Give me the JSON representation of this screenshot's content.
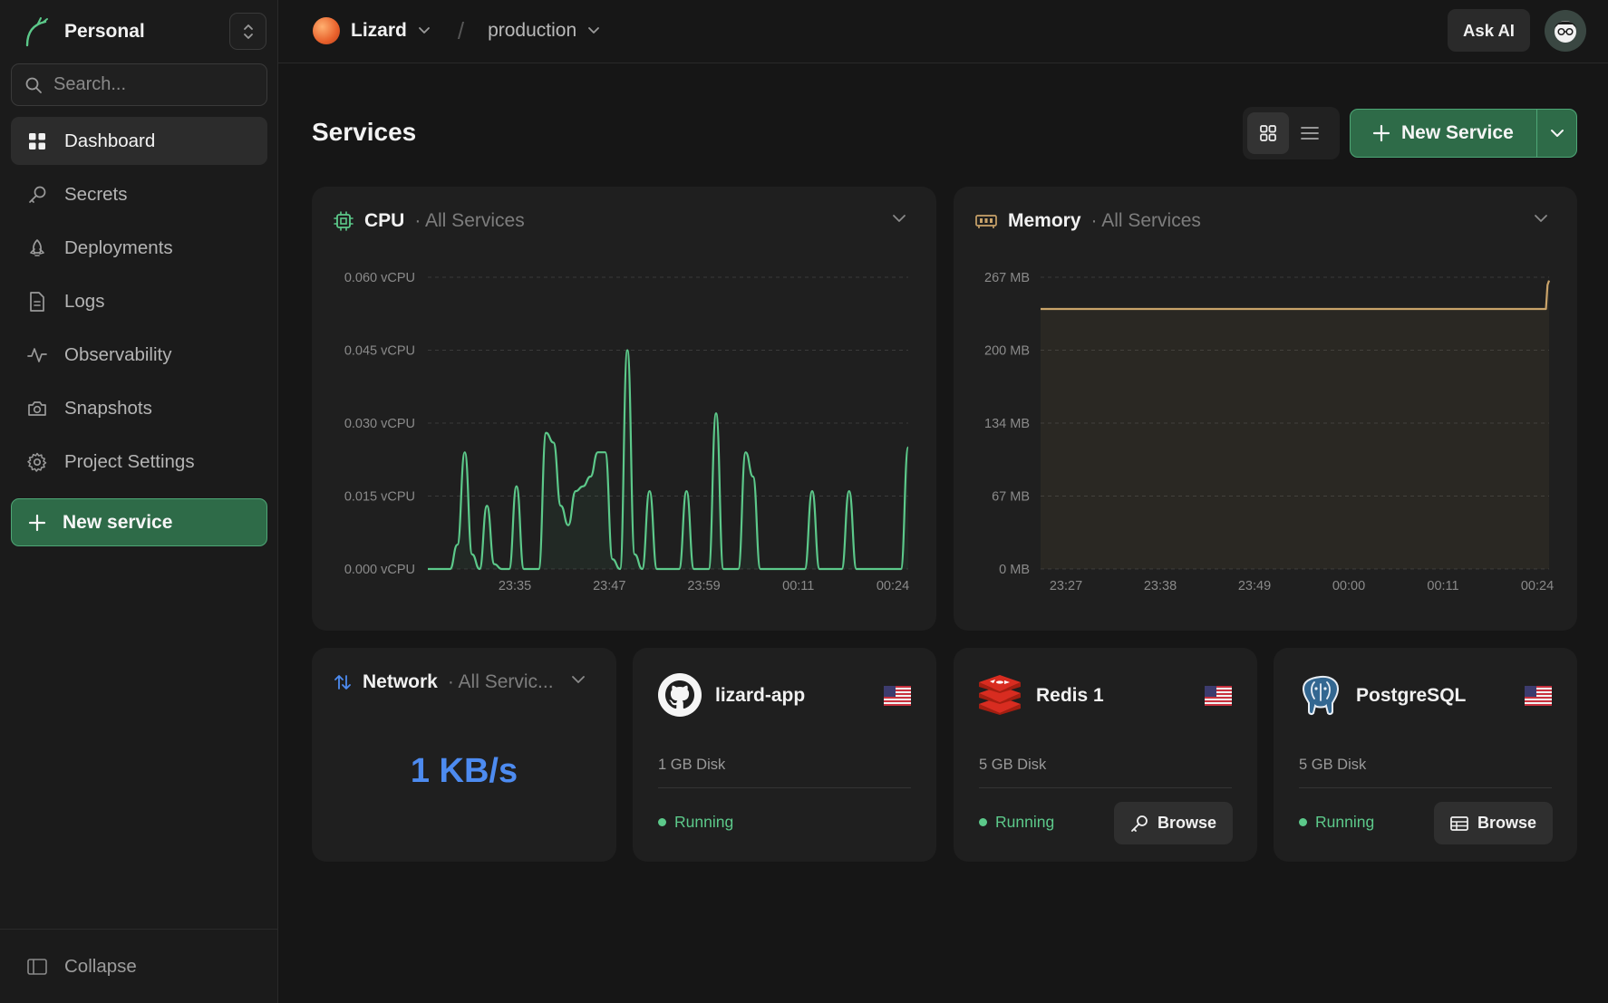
{
  "workspace": {
    "name": "Personal"
  },
  "search": {
    "placeholder": "Search..."
  },
  "sidebar": {
    "items": [
      {
        "label": "Dashboard",
        "icon": "grid-icon",
        "active": true
      },
      {
        "label": "Secrets",
        "icon": "key-icon"
      },
      {
        "label": "Deployments",
        "icon": "rocket-icon"
      },
      {
        "label": "Logs",
        "icon": "file-icon"
      },
      {
        "label": "Observability",
        "icon": "activity-icon"
      },
      {
        "label": "Snapshots",
        "icon": "camera-icon"
      },
      {
        "label": "Project Settings",
        "icon": "gear-icon"
      }
    ],
    "new_service_label": "New service",
    "collapse_label": "Collapse"
  },
  "topbar": {
    "project": "Lizard",
    "environment": "production",
    "ask_ai": "Ask AI"
  },
  "main": {
    "title": "Services",
    "new_service_label": "New Service"
  },
  "colors": {
    "accent_green": "#2e6b48",
    "cpu_line": "#5cc98a",
    "memory_line": "#c9a36a",
    "network_value": "#4d8bf0",
    "status_running": "#5cc98a"
  },
  "cpu_card": {
    "title": "CPU",
    "subtitle": "· All Services"
  },
  "memory_card": {
    "title": "Memory",
    "subtitle": "· All Services"
  },
  "network_card": {
    "title": "Network",
    "subtitle": "· All Servic...",
    "value": "1 KB/s"
  },
  "services": [
    {
      "name": "lizard-app",
      "icon": "github-icon",
      "disk": "1 GB Disk",
      "status": "Running",
      "browse": null
    },
    {
      "name": "Redis 1",
      "icon": "redis-icon",
      "disk": "5 GB Disk",
      "status": "Running",
      "browse": "Browse",
      "browse_icon": "key-icon"
    },
    {
      "name": "PostgreSQL",
      "icon": "postgresql-icon",
      "disk": "5 GB Disk",
      "status": "Running",
      "browse": "Browse",
      "browse_icon": "table-icon"
    }
  ],
  "chart_data": [
    {
      "type": "line",
      "title": "CPU",
      "subtitle": "· All Services",
      "x_ticks": [
        "23:35",
        "23:47",
        "23:59",
        "00:11",
        "00:24"
      ],
      "y_ticks": [
        "0.000 vCPU",
        "0.015 vCPU",
        "0.030 vCPU",
        "0.045 vCPU",
        "0.060 vCPU"
      ],
      "ylim": [
        0,
        0.06
      ],
      "grid": true,
      "series": [
        {
          "values": [
            0,
            0,
            0,
            0,
            0.005,
            0.024,
            0.003,
            0,
            0.013,
            0.001,
            0,
            0,
            0.017,
            0,
            0,
            0,
            0.028,
            0.026,
            0.013,
            0.009,
            0.016,
            0.017,
            0.019,
            0.024,
            0.024,
            0.002,
            0,
            0.045,
            0.003,
            0,
            0.016,
            0,
            0,
            0,
            0,
            0.016,
            0,
            0,
            0,
            0.032,
            0,
            0,
            0,
            0.024,
            0.019,
            0,
            0,
            0,
            0,
            0,
            0,
            0,
            0.016,
            0,
            0,
            0,
            0,
            0.016,
            0,
            0,
            0,
            0,
            0,
            0,
            0,
            0.025
          ]
        }
      ]
    },
    {
      "type": "area",
      "title": "Memory",
      "subtitle": "· All Services",
      "x_ticks": [
        "23:27",
        "23:38",
        "23:49",
        "00:00",
        "00:11",
        "00:24"
      ],
      "y_ticks": [
        "0 MB",
        "67 MB",
        "134 MB",
        "200 MB",
        "267 MB"
      ],
      "ylim": [
        0,
        267
      ],
      "grid": true,
      "series": [
        {
          "values": [
            238,
            238,
            238,
            238,
            238,
            238,
            238,
            238,
            238,
            238,
            238,
            238,
            238,
            238,
            238,
            238,
            238,
            238,
            238,
            238,
            238,
            238,
            238,
            238,
            238,
            238,
            238,
            238,
            238,
            238,
            238,
            238,
            238,
            238,
            238,
            238,
            238,
            238,
            238,
            238,
            238,
            238,
            238,
            238,
            238,
            238,
            238,
            238,
            238,
            238,
            238,
            238,
            238,
            238,
            238,
            238,
            238,
            238,
            238,
            238,
            238,
            238,
            238,
            238,
            238,
            238,
            238,
            238,
            238,
            238,
            238,
            238,
            238,
            238,
            238,
            238,
            238,
            238,
            238,
            238,
            238,
            238,
            238,
            238,
            238,
            238,
            238,
            238,
            238,
            238,
            238,
            238,
            238,
            238,
            238,
            238,
            238,
            238,
            238,
            238,
            238,
            238,
            238,
            238,
            238,
            238,
            238,
            238,
            238,
            238,
            238,
            238,
            238,
            238,
            238,
            238,
            238,
            238,
            238,
            238,
            238,
            238,
            238,
            238,
            238,
            238,
            238,
            238,
            238,
            238,
            238,
            238,
            238,
            238,
            238,
            238,
            238,
            238,
            238,
            238,
            238,
            238,
            238,
            238,
            238,
            238,
            238,
            238,
            238,
            238,
            238,
            238,
            238,
            238,
            238,
            238,
            238,
            238,
            238,
            238,
            238,
            238,
            238,
            238,
            238,
            238,
            238,
            238,
            238,
            238,
            238,
            238,
            238,
            238,
            238,
            238,
            238,
            238,
            238,
            238,
            238,
            238,
            238,
            238,
            238,
            238,
            238,
            238,
            238,
            238,
            238,
            238,
            238,
            238,
            238,
            238,
            238,
            238,
            238,
            238,
            238,
            238,
            238,
            238,
            238,
            238,
            238,
            238,
            238,
            238,
            238,
            238,
            238,
            238,
            238,
            238,
            238,
            238,
            238,
            238,
            238,
            238,
            238,
            238,
            238,
            238,
            238,
            238,
            238,
            238,
            238,
            238,
            238,
            238,
            238,
            238,
            238,
            238,
            238,
            238,
            238,
            238,
            238,
            238,
            238,
            238,
            238,
            238,
            238,
            238,
            238,
            238,
            238,
            238,
            238,
            238,
            238,
            238,
            238,
            238,
            238,
            238,
            238,
            238,
            238,
            238,
            238,
            238,
            238,
            238,
            238,
            238,
            238,
            238,
            238,
            238,
            238,
            238,
            238,
            238,
            238,
            238,
            238,
            238,
            238,
            238,
            238,
            238,
            238,
            238,
            238,
            238,
            238,
            238,
            238,
            238,
            238,
            238,
            238,
            238,
            238,
            238,
            238,
            238,
            238,
            238,
            238,
            238,
            238,
            238,
            238,
            238,
            238,
            238,
            238,
            238,
            238,
            238,
            238,
            238,
            238,
            238,
            238,
            238,
            260,
            264
          ]
        }
      ]
    }
  ]
}
